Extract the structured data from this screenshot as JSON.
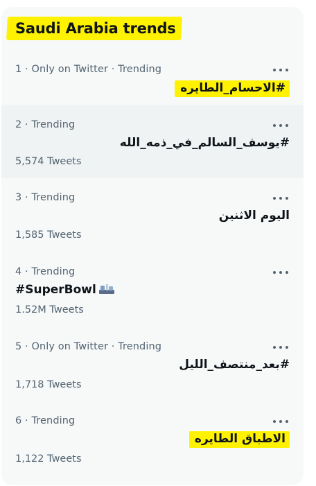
{
  "header": {
    "title": "Saudi Arabia trends"
  },
  "trends": [
    {
      "meta": "1 · Only on Twitter · Trending",
      "name": "#الاحسام_الطايره",
      "count": ""
    },
    {
      "meta": "2 · Trending",
      "name": "#يوسف_السالم_في_ذمه_الله",
      "count": "5,574 Tweets"
    },
    {
      "meta": "3 · Trending",
      "name": "اليوم الاثنين",
      "count": "1,585 Tweets"
    },
    {
      "meta": "4 · Trending",
      "name": "#SuperBowl",
      "count": "1.52M Tweets",
      "badge_icon": "super-bowl-badge-icon"
    },
    {
      "meta": "5 · Only on Twitter · Trending",
      "name": "#بعد_منتصف_الليل",
      "count": "1,718 Tweets"
    },
    {
      "meta": "6 · Trending",
      "name": "الاطباق الطايره",
      "count": "1,122 Tweets"
    }
  ],
  "colors": {
    "highlight": "#fff200",
    "panel_bg": "#f7f9f9",
    "hover_bg": "#eff3f4",
    "primary_text": "#0f1419",
    "secondary_text": "#536471"
  },
  "icons": {
    "more": "more-horizontal-icon"
  }
}
